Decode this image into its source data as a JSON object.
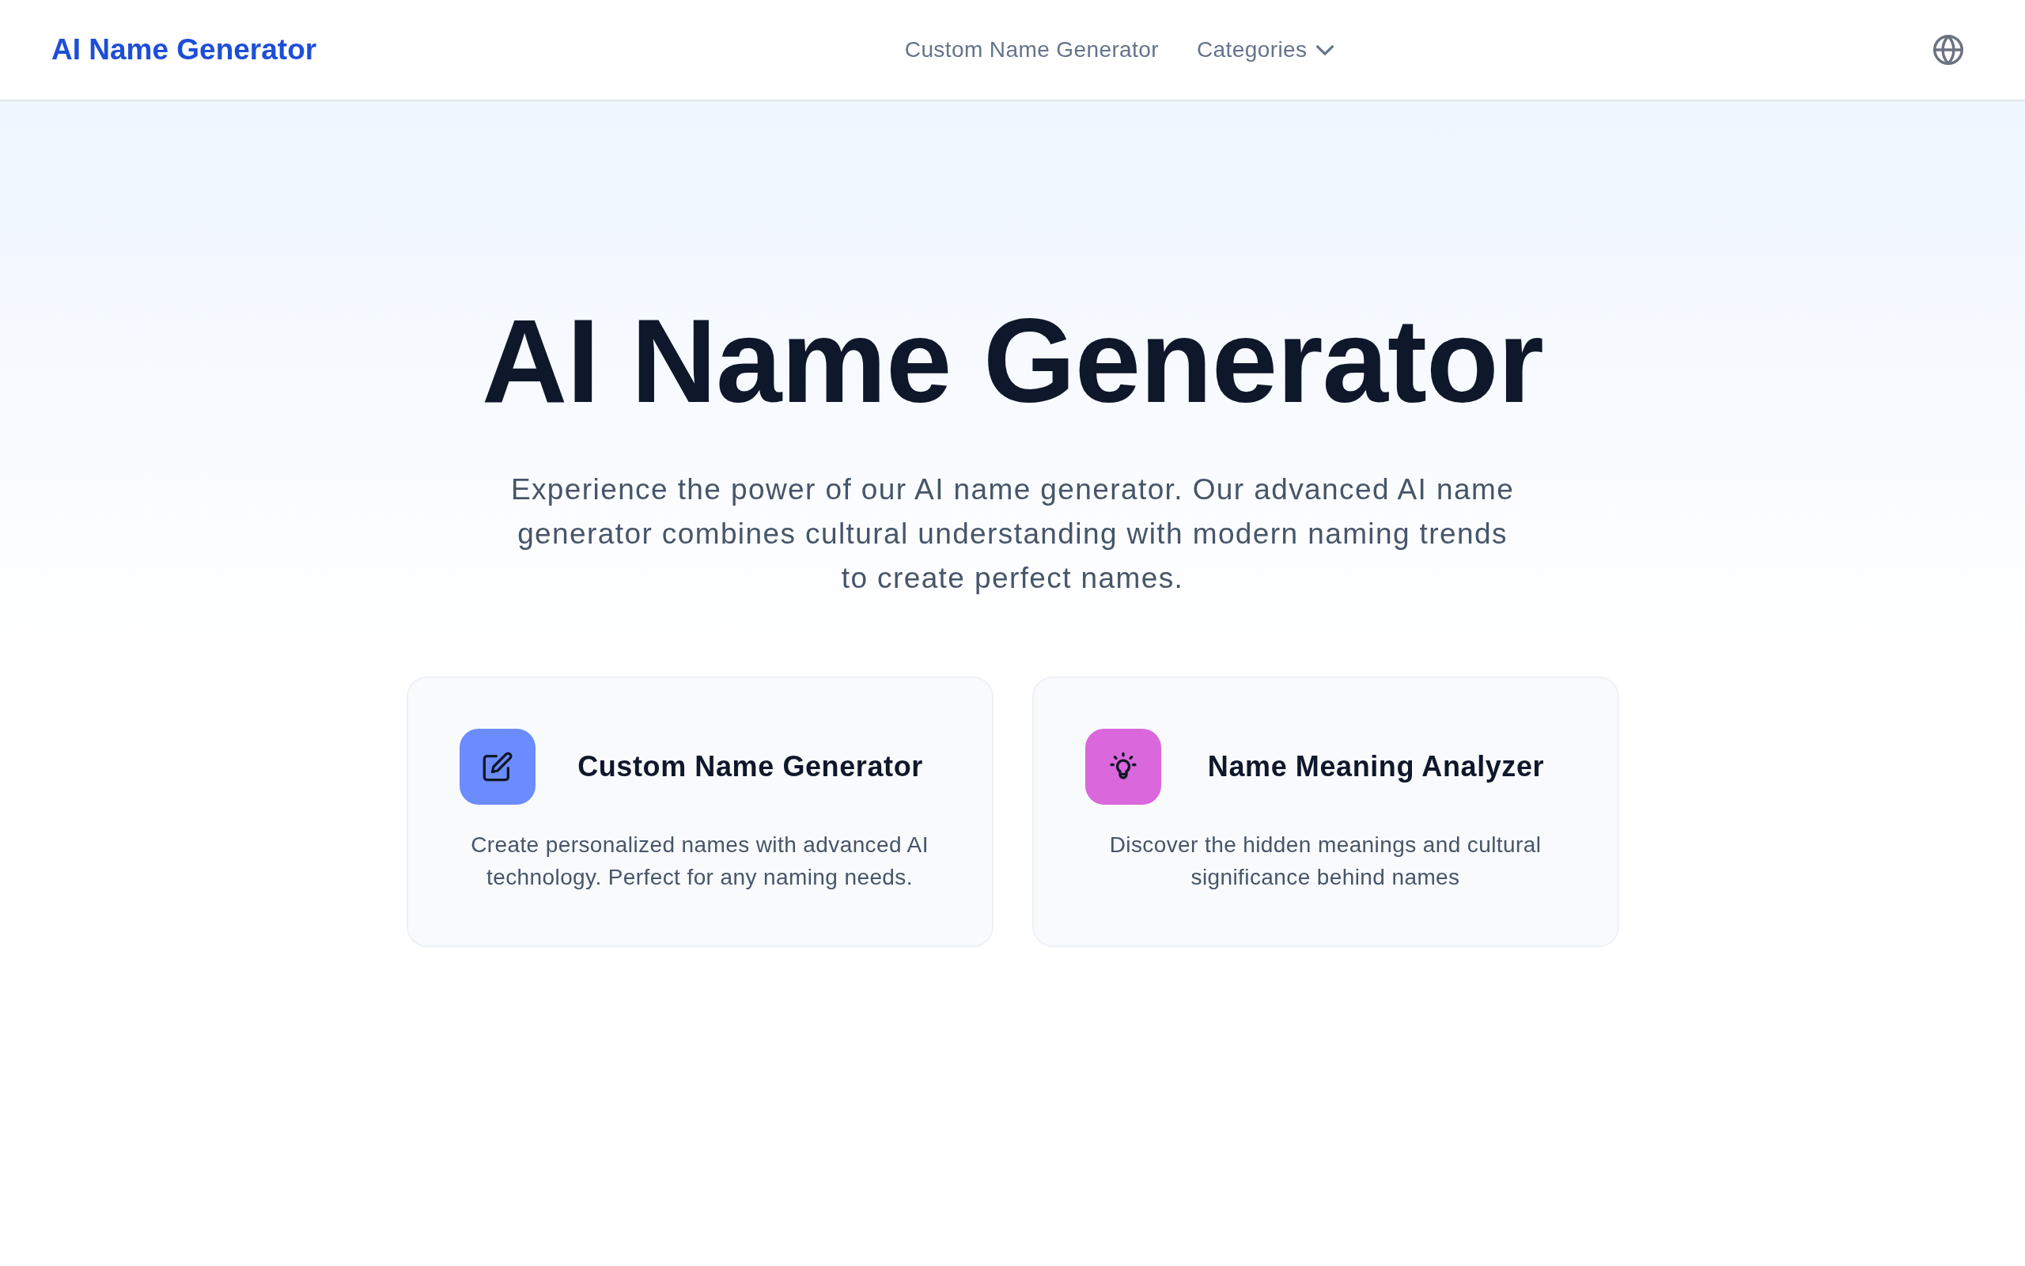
{
  "header": {
    "logo": "AI Name Generator",
    "nav": [
      {
        "label": "Custom Name Generator",
        "kind": "link"
      },
      {
        "label": "Categories",
        "kind": "dropdown"
      }
    ]
  },
  "hero": {
    "title": "AI Name Generator",
    "description": "Experience the power of our AI name generator. Our advanced AI name generator combines cultural understanding with modern naming trends to create perfect names."
  },
  "features": [
    {
      "title": "Custom Name Generator",
      "description": "Create personalized names with advanced AI technology. Perfect for any naming needs.",
      "color": "#6b8cfe"
    },
    {
      "title": "Name Meaning Analyzer",
      "description": "Discover the hidden meanings and cultural significance behind names",
      "color": "#da67dc"
    }
  ]
}
